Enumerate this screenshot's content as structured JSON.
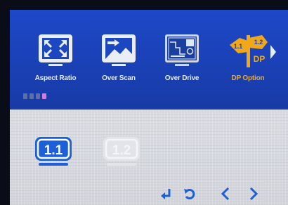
{
  "menu": {
    "items": [
      {
        "label": "Aspect Ratio",
        "icon": "aspect-ratio-icon"
      },
      {
        "label": "Over Scan",
        "icon": "over-scan-icon"
      },
      {
        "label": "Over Drive",
        "icon": "over-drive-icon"
      },
      {
        "label": "DP Option",
        "icon": "dp-option-icon",
        "selected": true
      }
    ],
    "selected_color": "#f0a818",
    "more_icon": "chevron-right-icon"
  },
  "dp_option_icon_text": {
    "a": "1.1",
    "b": "1.2",
    "c": "DP"
  },
  "page_indicator": {
    "count": 4,
    "active_index": 3
  },
  "options": [
    {
      "label": "1.1",
      "selected": true
    },
    {
      "label": "1.2",
      "selected": false
    }
  ],
  "footer": {
    "buttons": [
      "enter-icon",
      "back-icon",
      "left-arrow-icon",
      "right-arrow-icon"
    ]
  },
  "colors": {
    "band": "#1a40b4",
    "lower": "#d6d9df",
    "accent": "#1c5fd8"
  }
}
